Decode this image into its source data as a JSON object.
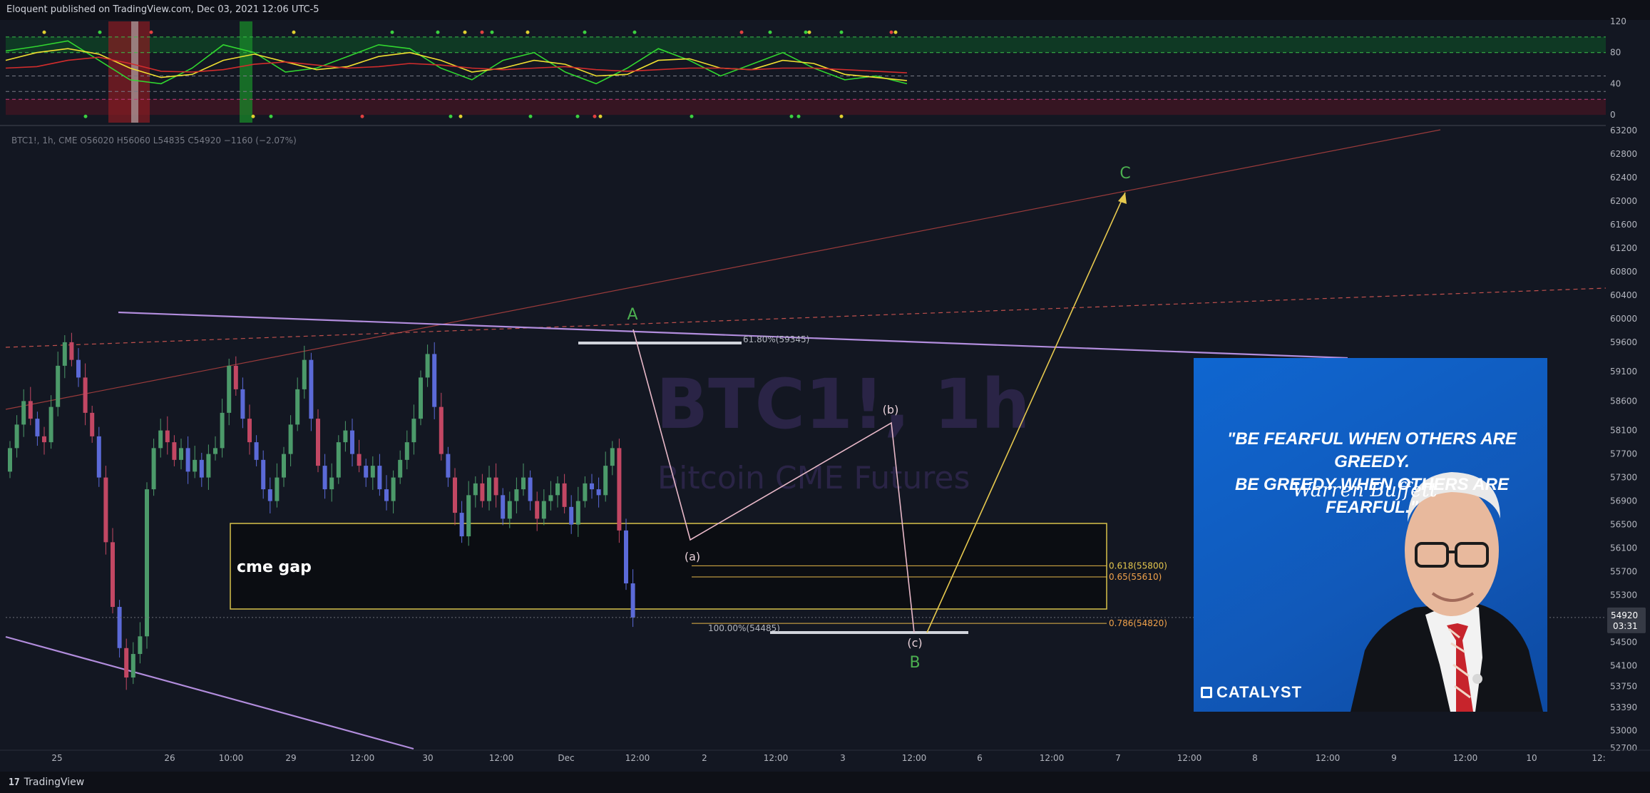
{
  "header": {
    "published": "Eloquent published on TradingView.com, Dec 03, 2021 12:06 UTC-5"
  },
  "footer": {
    "brand": "TradingView",
    "brand_icon": "tradingview-logo-icon"
  },
  "symbol": {
    "legend": "BTC1!, 1h, CME  O56020  H56060  L54835  C54920  −1160 (−2.07%)"
  },
  "watermark": {
    "line1": "BTC1!, 1h",
    "line2": "Bitcoin CME Futures"
  },
  "current_price": {
    "value": "54920",
    "countdown": "03:31"
  },
  "colors": {
    "background": "#131722",
    "bull": "#4c9a6a",
    "bear": "#c24763",
    "blue_candle": "#5b6ad8",
    "purple_line": "#b28ddd",
    "fib_yellow": "#e6c84e",
    "wave_label_green": "#4caf50",
    "orange_label": "#f2a34b"
  },
  "annotations": {
    "gap_label": "cme gap",
    "waves": {
      "A": "A",
      "B": "B",
      "C": "C"
    },
    "subwaves": {
      "a": "(a)",
      "b": "(b)",
      "c": "(c)"
    },
    "fib_top": "61.80%(59345)",
    "fib_bottom": "100.00%(54485)",
    "fib_levels": [
      {
        "label": "0.618(55800)",
        "price": 55800
      },
      {
        "label": "0.65(55610)",
        "price": 55610
      },
      {
        "label": "0.786(54820)",
        "price": 54820
      }
    ]
  },
  "quote_card": {
    "line1": "\"BE FEARFUL WHEN OTHERS ARE GREEDY.",
    "line2": "BE GREEDY WHEN OTHERS ARE FEARFUL.\"",
    "author": "Warren Buffett",
    "brand": "CATALYST"
  },
  "chart_data": [
    {
      "type": "line",
      "title": "",
      "indicator_pane": true,
      "y_ticks": [
        "120",
        "80",
        "40",
        "0"
      ],
      "ylim": [
        -10,
        120
      ],
      "levels": [
        100,
        80,
        50,
        30,
        20
      ],
      "series": [
        {
          "values": [
            82,
            88,
            95,
            70,
            45,
            40,
            60,
            90,
            80,
            55,
            60,
            75,
            90,
            85,
            60,
            45,
            70,
            80,
            55,
            40,
            60,
            85,
            70,
            50,
            65,
            80,
            60,
            45,
            50,
            40
          ]
        },
        {
          "values": [
            70,
            80,
            85,
            78,
            60,
            48,
            52,
            70,
            78,
            68,
            58,
            62,
            75,
            80,
            70,
            55,
            60,
            70,
            65,
            50,
            52,
            70,
            72,
            60,
            58,
            70,
            66,
            52,
            48,
            44
          ]
        },
        {
          "values": [
            60,
            62,
            70,
            74,
            66,
            56,
            55,
            58,
            65,
            68,
            64,
            60,
            62,
            66,
            64,
            60,
            58,
            60,
            62,
            58,
            56,
            58,
            60,
            60,
            58,
            60,
            60,
            58,
            56,
            54
          ]
        }
      ]
    },
    {
      "type": "candlestick",
      "title": "",
      "y_ticks": [
        "63200",
        "62800",
        "62400",
        "62000",
        "61600",
        "61200",
        "60800",
        "60400",
        "60000",
        "59600",
        "59100",
        "58600",
        "58100",
        "57700",
        "57300",
        "56900",
        "56500",
        "56100",
        "55700",
        "55300",
        "54900",
        "54500",
        "54100",
        "53750",
        "53390",
        "53000",
        "52700"
      ],
      "ylim": [
        52600,
        63400
      ],
      "x_ticks": [
        "25",
        "26",
        "10:00",
        "29",
        "12:00",
        "30",
        "12:00",
        "Dec",
        "12:00",
        "2",
        "12:00",
        "3",
        "12:00",
        "6",
        "12:00",
        "7",
        "12:00",
        "8",
        "12:00",
        "9",
        "12:00",
        "10",
        "12:"
      ],
      "close": [
        57800,
        58200,
        58600,
        58300,
        58000,
        57900,
        58500,
        59200,
        59600,
        59300,
        59000,
        58400,
        58000,
        57300,
        56200,
        55100,
        54400,
        53900,
        54300,
        54600,
        57100,
        57800,
        58100,
        57900,
        57600,
        57800,
        57400,
        57600,
        57300,
        57700,
        57800,
        58400,
        59200,
        58800,
        58300,
        57900,
        57600,
        57100,
        56900,
        57300,
        57700,
        58200,
        58800,
        59300,
        58300,
        57500,
        57100,
        57300,
        57900,
        58100,
        57700,
        57500,
        57300,
        57500,
        57100,
        56900,
        57300,
        57600,
        57900,
        58300,
        59000,
        59400,
        58500,
        57700,
        57300,
        56700,
        56300,
        57000,
        57200,
        56900,
        57300,
        57000,
        56600,
        56900,
        57100,
        57300,
        56900,
        56600,
        56900,
        57000,
        57200,
        56800,
        56500,
        56900,
        57200,
        57100,
        57000,
        57500,
        57800,
        56400,
        55500,
        54920
      ]
    }
  ]
}
